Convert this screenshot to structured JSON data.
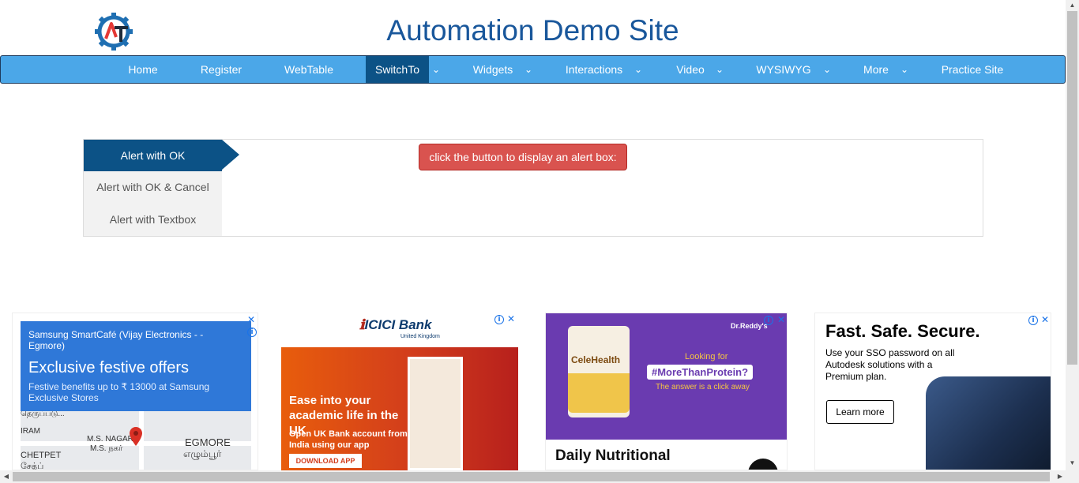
{
  "header": {
    "title": "Automation Demo Site",
    "logo_icon": "gear-AT-logo"
  },
  "nav": {
    "items": [
      {
        "label": "Home"
      },
      {
        "label": "Register"
      },
      {
        "label": "WebTable"
      },
      {
        "label": "SwitchTo",
        "active": true
      },
      {
        "label": "Widgets"
      },
      {
        "label": "Interactions"
      },
      {
        "label": "Video"
      },
      {
        "label": "WYSIWYG"
      },
      {
        "label": "More"
      },
      {
        "label": "Practice Site"
      }
    ],
    "caret": "⌄"
  },
  "alerts": {
    "tabs": [
      "Alert with OK",
      "Alert with OK & Cancel",
      "Alert with Textbox"
    ],
    "button_label": "click the button to display an alert box:"
  },
  "ads": {
    "samsung": {
      "store": "Samsung SmartCafé (Vijay Electronics - - Egmore)",
      "headline": "Exclusive festive offers",
      "body": "Festive benefits up to ₹ 13000 at Samsung Exclusive Stores",
      "map_labels": [
        "M.S. NAGAR",
        "M.S. நகர்",
        "EGMORE",
        "எழும்பூர்",
        "CHETPET",
        "சேத்ப்",
        "IRAM",
        "தெருப்படு..."
      ]
    },
    "icici": {
      "brand": "ICICI Bank",
      "region": "United Kingdom",
      "headline": "Ease into your academic life in the UK",
      "body": "Open UK Bank account from India using our app",
      "cta": "DOWNLOAD APP"
    },
    "drreddys": {
      "brand": "Dr.Reddy's",
      "product": "CeleHealth",
      "looking_for": "Looking for",
      "hashtag": "#MoreThanProtein?",
      "tagline": "The answer is a click away",
      "title": "Daily Nutritional"
    },
    "autodesk": {
      "headline": "Fast. Safe. Secure.",
      "body": "Use your SSO password on all Autodesk solutions with a Premium plan.",
      "cta": "Learn more"
    },
    "close_glyph": "✕",
    "info_glyph": "i"
  }
}
